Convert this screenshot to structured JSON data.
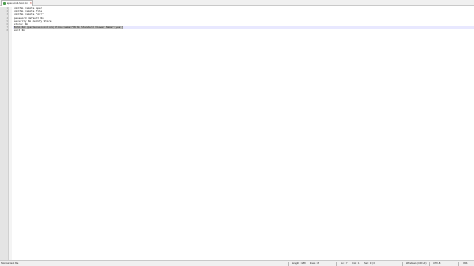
{
  "tab": {
    "label": "apex-cmd-func.txt",
    "close_glyph": "✕",
    "icon": "saved-file-icon",
    "icon_color": "#4a9c4a"
  },
  "editor": {
    "line_numbers": [
      "1",
      "2",
      "3",
      "4",
      "5",
      "6",
      "7",
      "8"
    ],
    "lines": [
      "cmd:No remote oper",
      "cmd:No remote file",
      "cmd:No remote \"Arr\"",
      "password default No",
      "security No modify Store",
      "store: No",
      "",
      "exit No"
    ],
    "current_line_index": 6,
    "selected_line_text": "Bitm:DA:(psrmscssiconlick)ltimu:name=\"Bitm Standard Viewer Name\":yes:]",
    "current_line_color": "#e8e8ff"
  },
  "status": {
    "file_type": "Normal text file",
    "length": "length : 188",
    "lines": "lines : 8",
    "ln": "Ln : 7",
    "col": "Col : 1",
    "sel": "Sel : 0 | 0",
    "eol": "Windows (CR LF)",
    "encoding": "UTF-8",
    "mode": "INS"
  }
}
